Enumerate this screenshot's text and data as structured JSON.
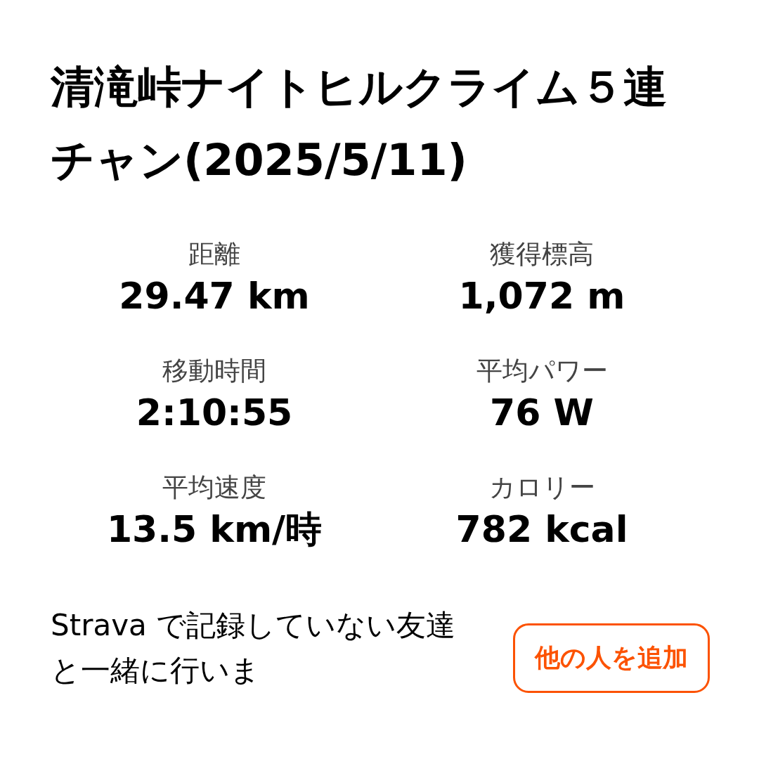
{
  "title": "清滝峠ナイトヒルクライム５連チャン(2025/5/11)",
  "stats": [
    {
      "label": "距離",
      "value": "29.47 km"
    },
    {
      "label": "獲得標高",
      "value": "1,072 m"
    },
    {
      "label": "移動時間",
      "value": "2:10:55"
    },
    {
      "label": "平均パワー",
      "value": "76 W"
    },
    {
      "label": "平均速度",
      "value": "13.5 km/時"
    },
    {
      "label": "カロリー",
      "value": "782 kcal"
    }
  ],
  "invite": {
    "text": "Strava で記録していない友達と一緒に行いま",
    "button": "他の人を追加"
  }
}
